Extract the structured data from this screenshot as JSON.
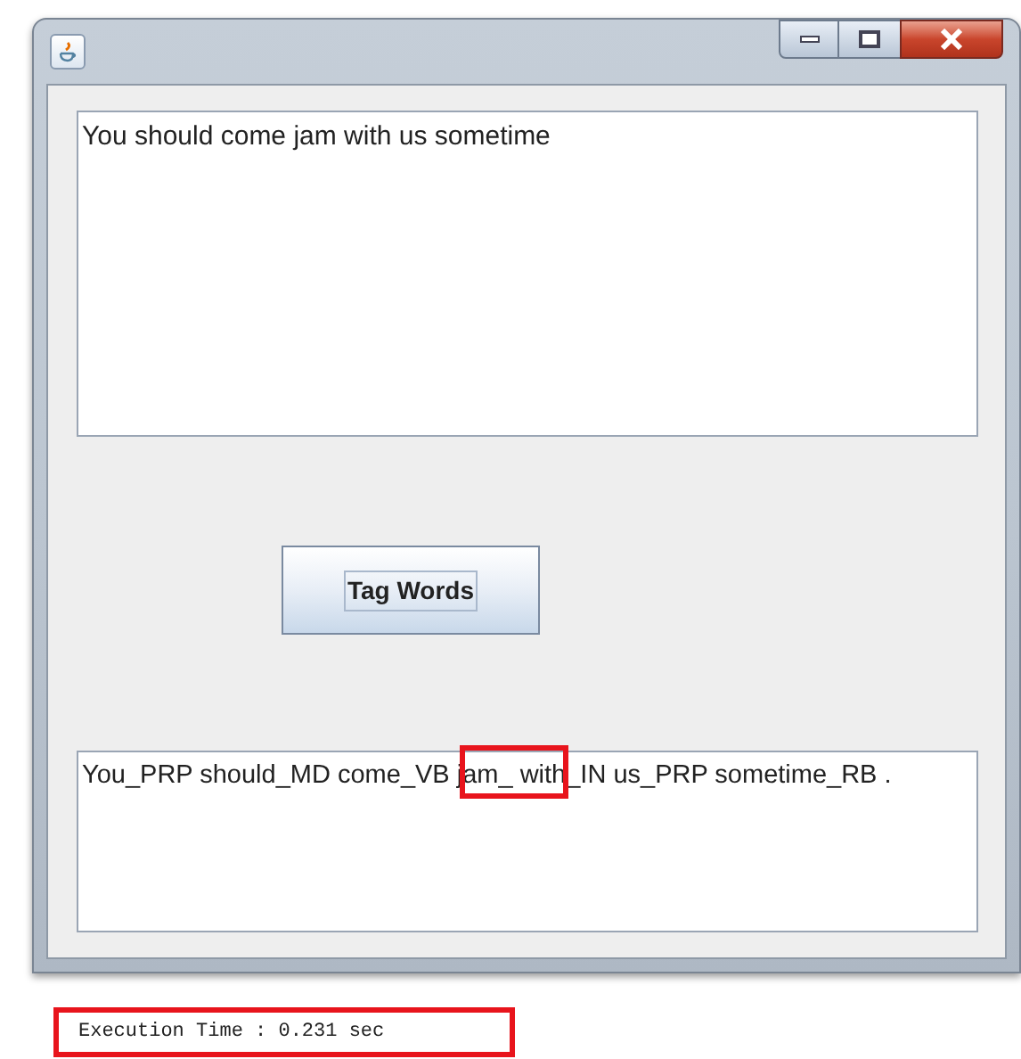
{
  "window": {
    "controls": [
      {
        "kind": "minimize"
      },
      {
        "kind": "maximize"
      },
      {
        "kind": "close"
      }
    ]
  },
  "input": {
    "value": "You should come jam with us sometime"
  },
  "button": {
    "label": "Tag Words"
  },
  "output": {
    "value": "You_PRP should_MD come_VB jam_ with_IN us_PRP sometime_RB ."
  },
  "execution_time": "Execution Time : 0.231 sec"
}
